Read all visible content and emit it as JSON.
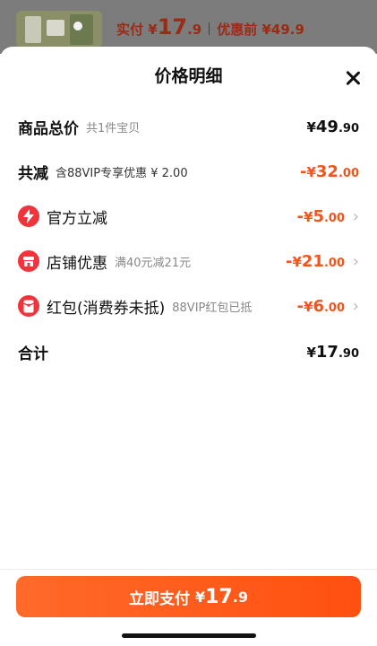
{
  "top": {
    "paid_label": "实付",
    "paid_int": "17",
    "paid_dec": ".9",
    "before_label": "优惠前",
    "before_amount": "¥49.9"
  },
  "sheet": {
    "title": "价格明细"
  },
  "rows": {
    "total": {
      "label": "商品总价",
      "sub": "共1件宝贝",
      "int": "49",
      "dec": ".90"
    },
    "discount": {
      "label": "共减",
      "sub": "含88VIP专享优惠 ¥ 2.00",
      "prefix": "-",
      "int": "32",
      "dec": ".00"
    },
    "official": {
      "label": "官方立减",
      "sub": "",
      "prefix": "-",
      "int": "5",
      "dec": ".00",
      "icon": "lightning-icon"
    },
    "shop": {
      "label": "店铺优惠",
      "sub": "满40元减21元",
      "prefix": "-",
      "int": "21",
      "dec": ".00",
      "icon": "shop-icon"
    },
    "redpacket": {
      "label": "红包(消费券未抵)",
      "sub": "88VIP红包已抵",
      "prefix": "-",
      "int": "6",
      "dec": ".00",
      "icon": "red-packet-icon"
    },
    "sum": {
      "label": "合计",
      "int": "17",
      "dec": ".90"
    }
  },
  "pay_button": {
    "label": "立即支付",
    "int": "17",
    "dec": ".9"
  },
  "colors": {
    "accent": "#f2541c",
    "icon_red": "#f1333b",
    "button": "#ff5a1f"
  }
}
